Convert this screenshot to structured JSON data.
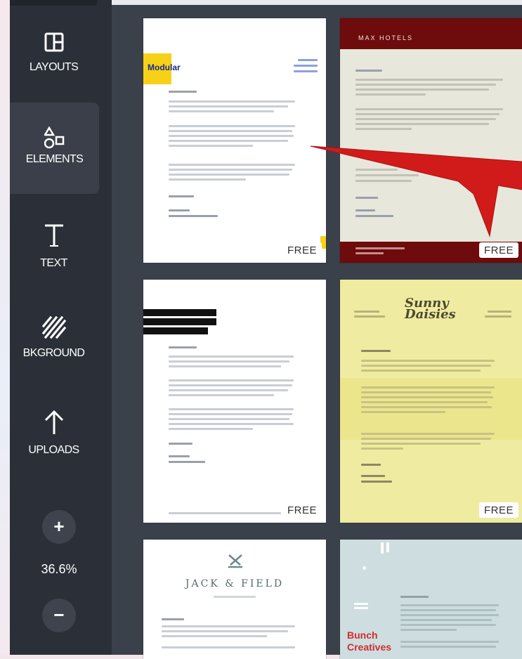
{
  "sidebar": {
    "items": [
      {
        "label": "LAYOUTS",
        "icon": "layouts-icon"
      },
      {
        "label": "ELEMENTS",
        "icon": "elements-icon"
      },
      {
        "label": "TEXT",
        "icon": "text-icon"
      },
      {
        "label": "BKGROUND",
        "icon": "background-icon"
      },
      {
        "label": "UPLOADS",
        "icon": "upload-arrow-icon"
      }
    ],
    "zoom": {
      "plus": "+",
      "value": "36.6%",
      "minus": "−"
    }
  },
  "templates": [
    {
      "title": "Modular",
      "badge": "FREE"
    },
    {
      "title": "MAX HOTELS",
      "badge": "FREE"
    },
    {
      "title": "",
      "badge": "FREE"
    },
    {
      "title": "Sunny Daisies",
      "badge": "FREE"
    },
    {
      "title": "JACK & FIELD",
      "badge": ""
    },
    {
      "title": "Bunch Creatives",
      "badge": ""
    }
  ],
  "colors": {
    "sidebar": "#2b2f37",
    "panel": "#3b414b",
    "annotation_arrow": "#d11b1b",
    "hotel_red": "#6e0b0c",
    "yellow_card": "#efeba0"
  }
}
